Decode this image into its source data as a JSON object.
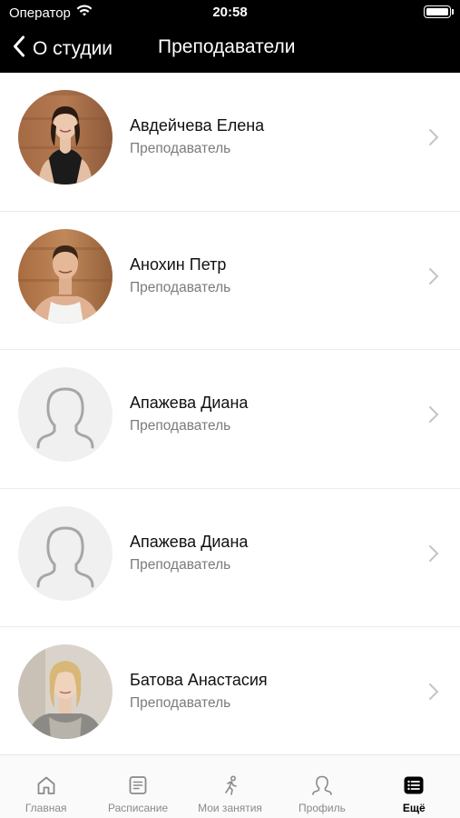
{
  "status_bar": {
    "carrier": "Оператор",
    "time": "20:58"
  },
  "nav": {
    "back_label": "О студии",
    "title": "Преподаватели"
  },
  "teachers": [
    {
      "name": "Авдейчева Елена",
      "role": "Преподаватель",
      "avatar": "photo-woman-dark-hair"
    },
    {
      "name": "Анохин Петр",
      "role": "Преподаватель",
      "avatar": "photo-man"
    },
    {
      "name": "Апажева Диана",
      "role": "Преподаватель",
      "avatar": "placeholder-person-icon"
    },
    {
      "name": "Апажева Диана",
      "role": "Преподаватель",
      "avatar": "placeholder-person-icon"
    },
    {
      "name": "Батова Анастасия",
      "role": "Преподаватель",
      "avatar": "photo-woman-blonde"
    }
  ],
  "tab_bar": {
    "tabs": [
      {
        "label": "Главная",
        "icon": "home-icon"
      },
      {
        "label": "Расписание",
        "icon": "schedule-icon"
      },
      {
        "label": "Мои занятия",
        "icon": "running-person-icon"
      },
      {
        "label": "Профиль",
        "icon": "profile-icon"
      },
      {
        "label": "Ещё",
        "icon": "more-list-icon"
      }
    ],
    "active": "Ещё"
  },
  "colors": {
    "header_bg": "#000000",
    "secondary_text": "#7b7b7b",
    "chevron": "#c4c4c6",
    "placeholder_bg": "#f0f0f0"
  }
}
